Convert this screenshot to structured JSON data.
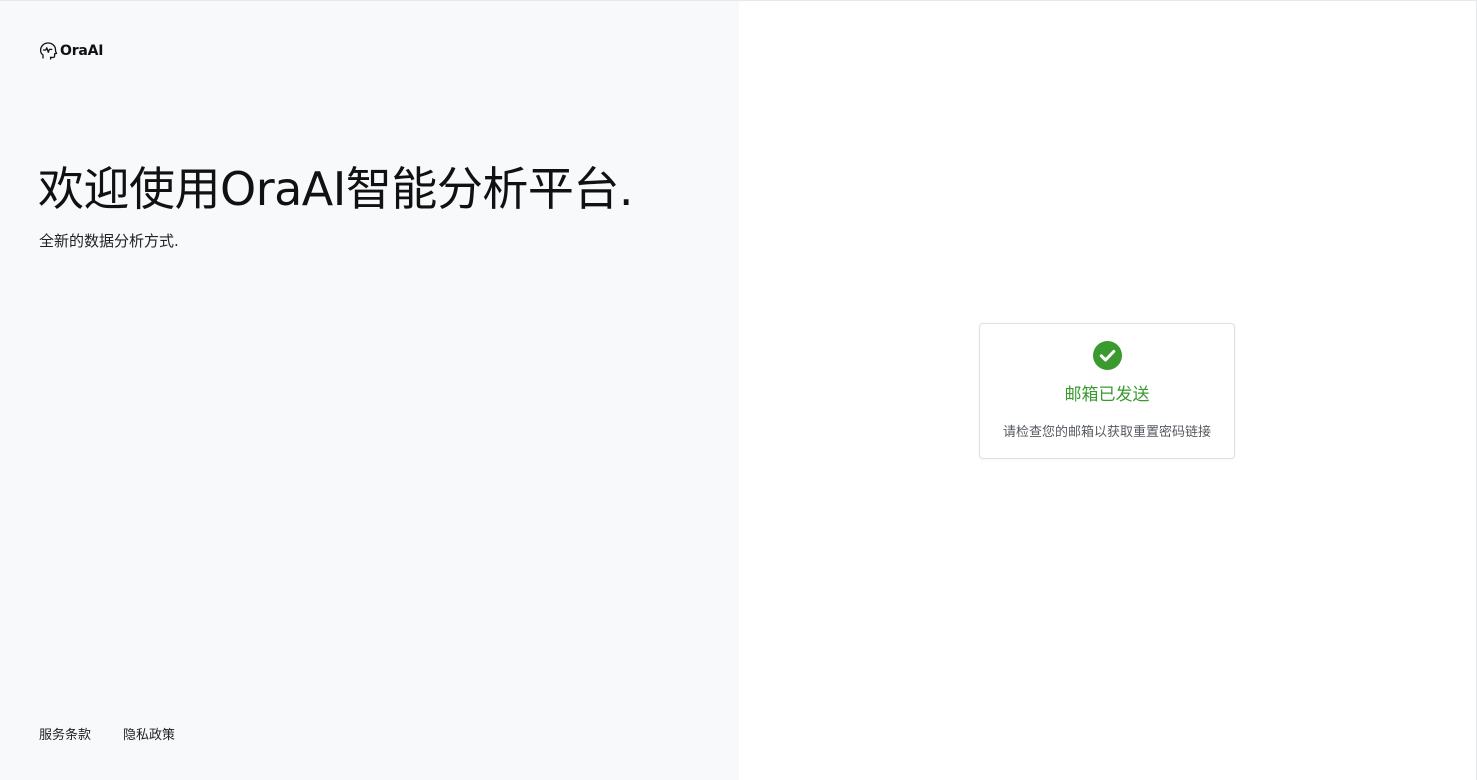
{
  "brand": {
    "name": "OraAI",
    "icon": "brain-head-icon"
  },
  "hero": {
    "title": "欢迎使用OraAI智能分析平台.",
    "subtitle": "全新的数据分析方式."
  },
  "footer": {
    "links": [
      {
        "label": "服务条款"
      },
      {
        "label": "隐私政策"
      }
    ]
  },
  "status_card": {
    "icon": "check-circle-icon",
    "title": "邮箱已发送",
    "message": "请检查您的邮箱以获取重置密码链接",
    "accent_color": "#3a9a2f"
  },
  "colors": {
    "left_panel_bg": "#f8f9fb",
    "right_panel_bg": "#ffffff",
    "success": "#3a9a2f"
  }
}
